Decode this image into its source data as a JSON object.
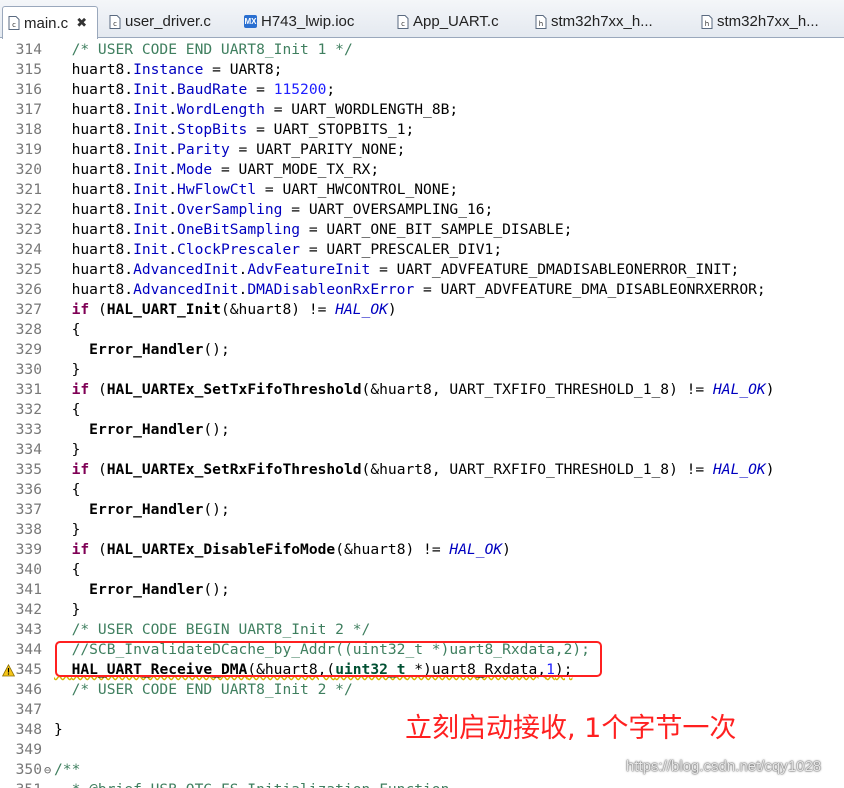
{
  "tabs": [
    {
      "label": "main.c",
      "icon": "c-file-icon",
      "active": true,
      "close": "✖"
    },
    {
      "label": "user_driver.c",
      "icon": "c-file-icon"
    },
    {
      "label": "H743_lwip.ioc",
      "icon": "cubemx-file-icon",
      "icon_text": "MX"
    },
    {
      "label": "App_UART.c",
      "icon": "c-file-icon"
    },
    {
      "label": "stm32h7xx_h...",
      "icon": "h-file-icon"
    },
    {
      "label": "stm32h7xx_h...",
      "icon": "h-file-icon"
    }
  ],
  "lines": [
    {
      "n": "314",
      "code": "  /* USER CODE END UART8_Init 1 */"
    },
    {
      "n": "315",
      "code": "  huart8.Instance = UART8;"
    },
    {
      "n": "316",
      "code": "  huart8.Init.BaudRate = 115200;"
    },
    {
      "n": "317",
      "code": "  huart8.Init.WordLength = UART_WORDLENGTH_8B;"
    },
    {
      "n": "318",
      "code": "  huart8.Init.StopBits = UART_STOPBITS_1;"
    },
    {
      "n": "319",
      "code": "  huart8.Init.Parity = UART_PARITY_NONE;"
    },
    {
      "n": "320",
      "code": "  huart8.Init.Mode = UART_MODE_TX_RX;"
    },
    {
      "n": "321",
      "code": "  huart8.Init.HwFlowCtl = UART_HWCONTROL_NONE;"
    },
    {
      "n": "322",
      "code": "  huart8.Init.OverSampling = UART_OVERSAMPLING_16;"
    },
    {
      "n": "323",
      "code": "  huart8.Init.OneBitSampling = UART_ONE_BIT_SAMPLE_DISABLE;"
    },
    {
      "n": "324",
      "code": "  huart8.Init.ClockPrescaler = UART_PRESCALER_DIV1;"
    },
    {
      "n": "325",
      "code": "  huart8.AdvancedInit.AdvFeatureInit = UART_ADVFEATURE_DMADISABLEONERROR_INIT;"
    },
    {
      "n": "326",
      "code": "  huart8.AdvancedInit.DMADisableonRxError = UART_ADVFEATURE_DMA_DISABLEONRXERROR;"
    },
    {
      "n": "327",
      "code": "  if (HAL_UART_Init(&huart8) != HAL_OK)"
    },
    {
      "n": "328",
      "code": "  {"
    },
    {
      "n": "329",
      "code": "    Error_Handler();"
    },
    {
      "n": "330",
      "code": "  }"
    },
    {
      "n": "331",
      "code": "  if (HAL_UARTEx_SetTxFifoThreshold(&huart8, UART_TXFIFO_THRESHOLD_1_8) != HAL_OK)"
    },
    {
      "n": "332",
      "code": "  {"
    },
    {
      "n": "333",
      "code": "    Error_Handler();"
    },
    {
      "n": "334",
      "code": "  }"
    },
    {
      "n": "335",
      "code": "  if (HAL_UARTEx_SetRxFifoThreshold(&huart8, UART_RXFIFO_THRESHOLD_1_8) != HAL_OK)"
    },
    {
      "n": "336",
      "code": "  {"
    },
    {
      "n": "337",
      "code": "    Error_Handler();"
    },
    {
      "n": "338",
      "code": "  }"
    },
    {
      "n": "339",
      "code": "  if (HAL_UARTEx_DisableFifoMode(&huart8) != HAL_OK)"
    },
    {
      "n": "340",
      "code": "  {"
    },
    {
      "n": "341",
      "code": "    Error_Handler();"
    },
    {
      "n": "342",
      "code": "  }"
    },
    {
      "n": "343",
      "code": "  /* USER CODE BEGIN UART8_Init 2 */"
    },
    {
      "n": "344",
      "code": "  //SCB_InvalidateDCache_by_Addr((uint32_t *)uart8_Rxdata,2);"
    },
    {
      "n": "345",
      "code": "  HAL_UART_Receive_DMA(&huart8,(uint32_t *)uart8_Rxdata,1);",
      "warning": true
    },
    {
      "n": "346",
      "code": "  /* USER CODE END UART8_Init 2 */"
    },
    {
      "n": "347",
      "code": ""
    },
    {
      "n": "348",
      "code": "}"
    },
    {
      "n": "349",
      "code": ""
    },
    {
      "n": "350",
      "code": "/**",
      "fold": "⊖"
    },
    {
      "n": "351",
      "code": "  * @brief USB_OTG_FS Initialization Function"
    }
  ],
  "annotation": {
    "text": "立刻启动接收, 1个字节一次",
    "color": "#ff2020"
  },
  "watermark": "https://blog.csdn.net/cqy1028",
  "colors": {
    "comment": "#3f7f5f",
    "keyword": "#7f0055",
    "field": "#0000c0",
    "number": "#2020ff",
    "highlight_box": "#ff2020"
  }
}
